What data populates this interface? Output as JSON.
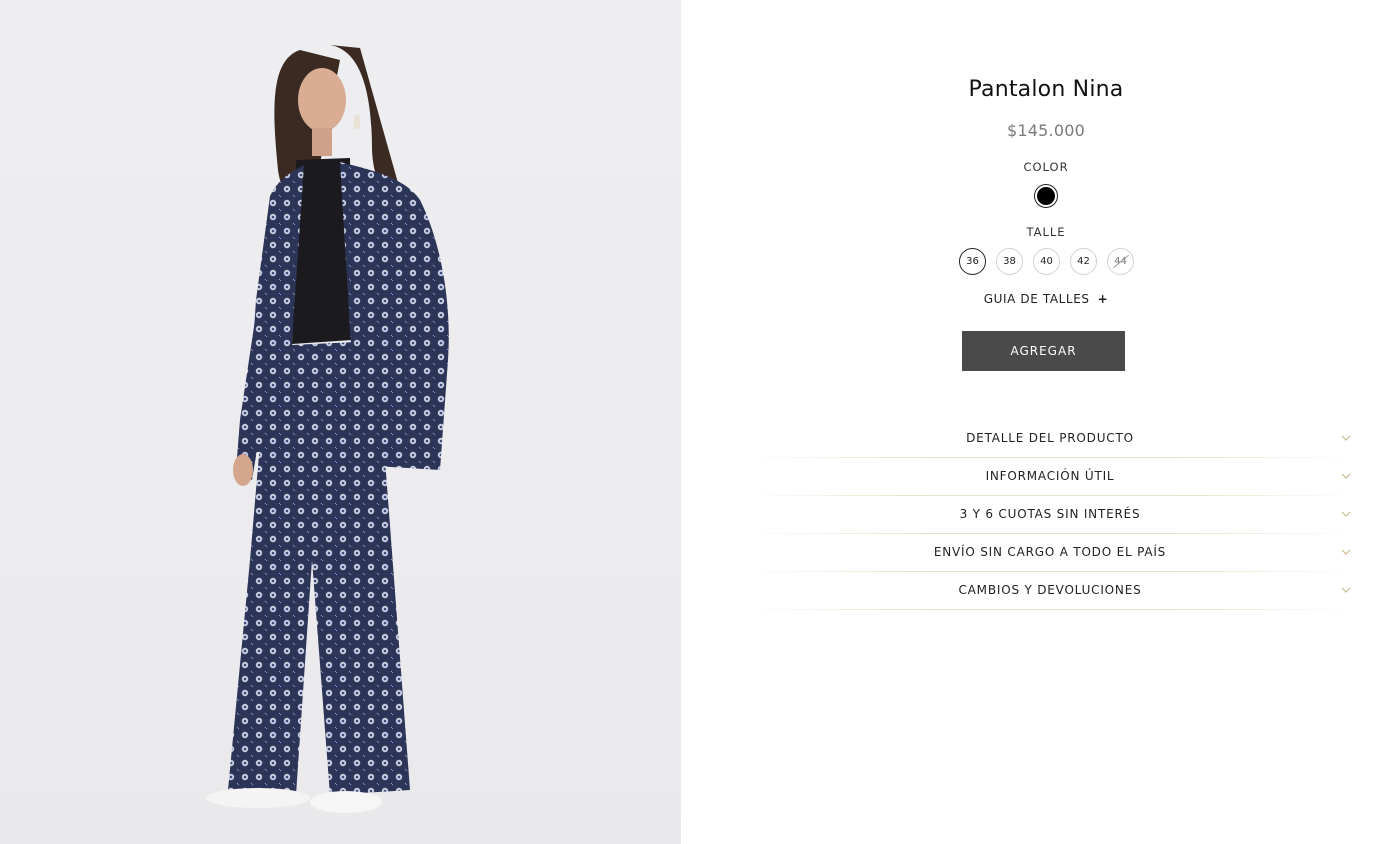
{
  "product": {
    "name": "Pantalon Nina",
    "price": "$145.000"
  },
  "color": {
    "label": "COLOR",
    "options": [
      {
        "name": "black",
        "hex": "#000000",
        "selected": true
      }
    ]
  },
  "size": {
    "label": "TALLE",
    "options": [
      {
        "label": "36",
        "selected": true,
        "available": true
      },
      {
        "label": "38",
        "selected": false,
        "available": true
      },
      {
        "label": "40",
        "selected": false,
        "available": true
      },
      {
        "label": "42",
        "selected": false,
        "available": true
      },
      {
        "label": "44",
        "selected": false,
        "available": false
      }
    ],
    "guide_label": "GUIA DE TALLES",
    "guide_icon": "+"
  },
  "add_button_label": "AGREGAR",
  "accordion": [
    {
      "label": "DETALLE DEL PRODUCTO",
      "icon": "chevron-down-icon"
    },
    {
      "label": "INFORMACIÓN ÚTIL",
      "icon": "chevron-down-icon"
    },
    {
      "label": "3 Y 6 CUOTAS SIN INTERÉS",
      "icon": "chevron-down-icon"
    },
    {
      "label": "ENVÍO SIN CARGO A TODO EL PAÍS",
      "icon": "chevron-down-icon"
    },
    {
      "label": "CAMBIOS Y DEVOLUCIONES",
      "icon": "chevron-down-icon"
    }
  ],
  "colors": {
    "button_bg": "#4a4a4a",
    "divider": "#e7e1c7",
    "chevron": "#c9b98a",
    "price": "#7a7a7a"
  }
}
